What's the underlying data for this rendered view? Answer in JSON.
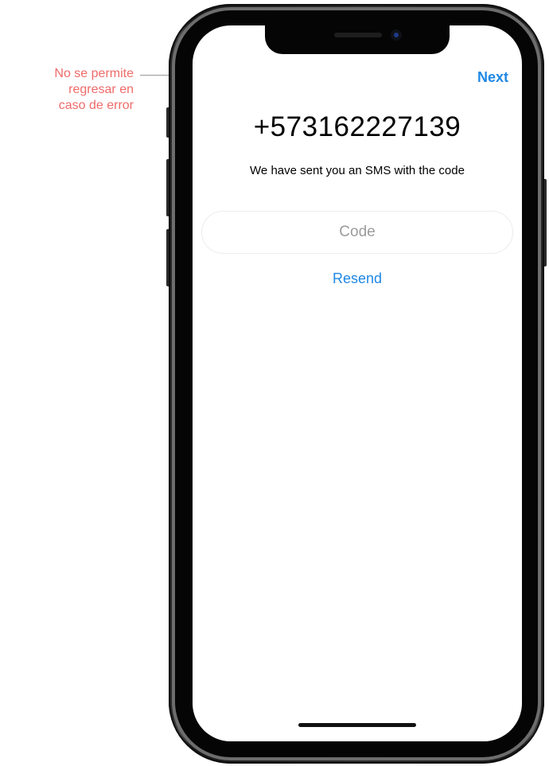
{
  "annotation": {
    "line1": "No se permite",
    "line2": "regresar en",
    "line3": "caso de error"
  },
  "header": {
    "next_label": "Next"
  },
  "verification": {
    "phone_number": "+573162227139",
    "message": "We have sent you an SMS with the code",
    "code_placeholder": "Code",
    "code_value": "",
    "resend_label": "Resend"
  },
  "colors": {
    "accent": "#1e88e5",
    "annotation": "#f06a6a"
  }
}
